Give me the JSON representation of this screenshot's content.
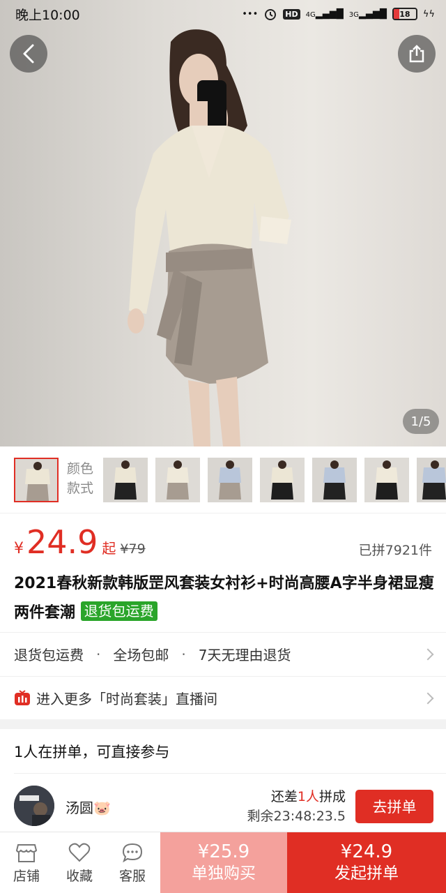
{
  "status_bar": {
    "time": "晚上10:00",
    "hd": "HD",
    "net1": "4G",
    "net2": "3G",
    "battery": "18"
  },
  "gallery": {
    "pager": "1/5",
    "thumb_count": 8,
    "variant_label_1": "颜色",
    "variant_label_2": "款式"
  },
  "price": {
    "currency": "¥",
    "value": "24.9",
    "suffix": "起",
    "original": "¥79",
    "sold": "已拼7921件"
  },
  "product": {
    "title": "2021春秋新款韩版罡风套装女衬衫+时尚高腰A字半身裙显瘦两件套潮",
    "tag": "退货包运费"
  },
  "services": {
    "items": [
      "退货包运费",
      "全场包邮",
      "7天无理由退货"
    ],
    "separator": "·"
  },
  "live": {
    "text": "进入更多「时尚套装」直播间"
  },
  "group": {
    "heading": "1人在拼单，可直接参与",
    "member_name": "汤圆🐷",
    "need_prefix": "还差",
    "need_count": "1人",
    "need_suffix": "拼成",
    "remain": "剩余23:48:23.5",
    "join_label": "去拼单"
  },
  "bottom_bar": {
    "store": "店铺",
    "favorite": "收藏",
    "service": "客服",
    "buy_alone_price": "¥25.9",
    "buy_alone_label": "单独购买",
    "group_price": "¥24.9",
    "group_label": "发起拼单"
  },
  "colors": {
    "accent": "#e02e24",
    "accent_light": "#f4a19c",
    "tag_green": "#2aa52a"
  }
}
